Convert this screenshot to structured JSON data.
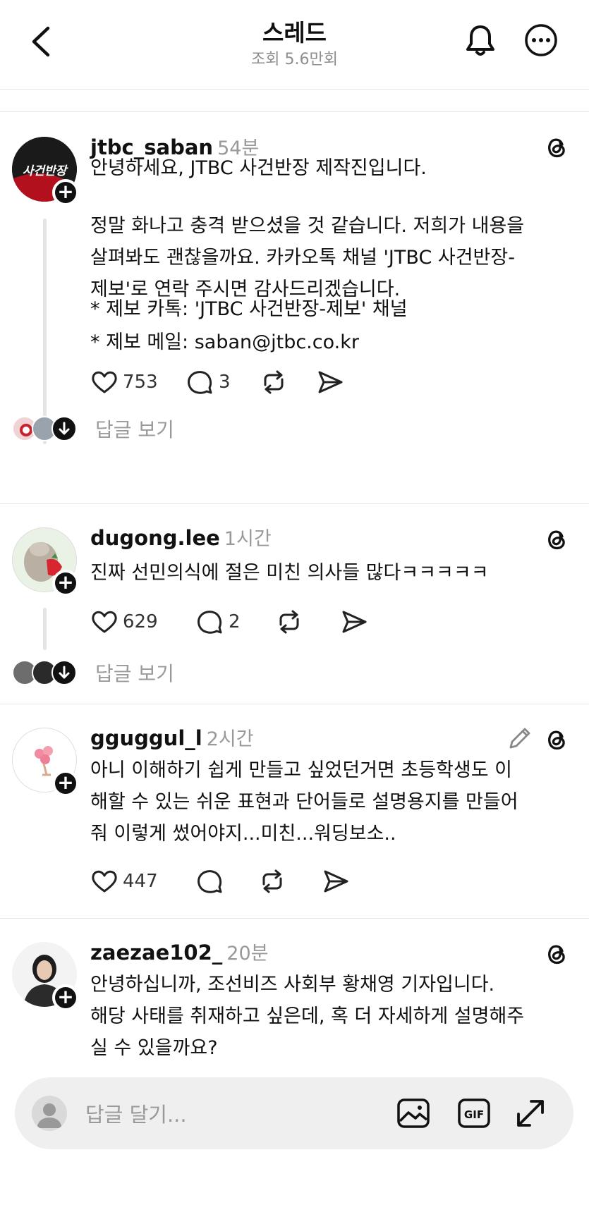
{
  "header": {
    "title": "스레드",
    "views": "조회 5.6만회"
  },
  "posts": [
    {
      "username": "jtbc_saban",
      "time": "54분",
      "avatar_text": "사건반장",
      "lines": [
        "안녕하세요, JTBC 사건반장 제작진입니다."
      ],
      "para2": [
        "정말 화나고 충격 받으셨을 것 같습니다. 저희가 내용을",
        "살펴봐도 괜찮을까요. 카카오톡 채널 'JTBC 사건반장-",
        "제보'로 연락 주시면 감사드리겠습니다."
      ],
      "para3": [
        "* 제보 카톡: 'JTBC 사건반장-제보' 채널",
        "* 제보 메일: saban@jtbc.co.kr"
      ],
      "likes": "753",
      "comments": "3",
      "see_replies": "답글 보기"
    },
    {
      "username": "dugong.lee",
      "time": "1시간",
      "lines": [
        "진짜 선민의식에 절은 미친 의사들 많다ㅋㅋㅋㅋㅋ"
      ],
      "likes": "629",
      "comments": "2",
      "see_replies": "답글 보기"
    },
    {
      "username": "gguggul_l",
      "time": "2시간",
      "lines": [
        "아니 이해하기 쉽게 만들고 싶었던거면 초등학생도 이",
        "해할 수 있는 쉬운 표현과 단어들로 설명용지를 만들어",
        "줘 이렇게 썼어야지...미친...워딩보소.."
      ],
      "likes": "447"
    },
    {
      "username": "zaezae102_",
      "time": "20분",
      "lines": [
        "안녕하십니까, 조선비즈 사회부 황채영 기자입니다.",
        "해당 사태를 취재하고 싶은데, 혹 더 자세하게 설명해주",
        "실 수 있을까요?"
      ]
    }
  ],
  "composer": {
    "placeholder": "답글 달기..."
  },
  "icons": [
    "back-icon",
    "bell-icon",
    "more-icon",
    "threads-icon",
    "heart-icon",
    "comment-icon",
    "repost-icon",
    "share-icon",
    "edit-icon",
    "image-icon",
    "gif-icon",
    "expand-icon"
  ]
}
